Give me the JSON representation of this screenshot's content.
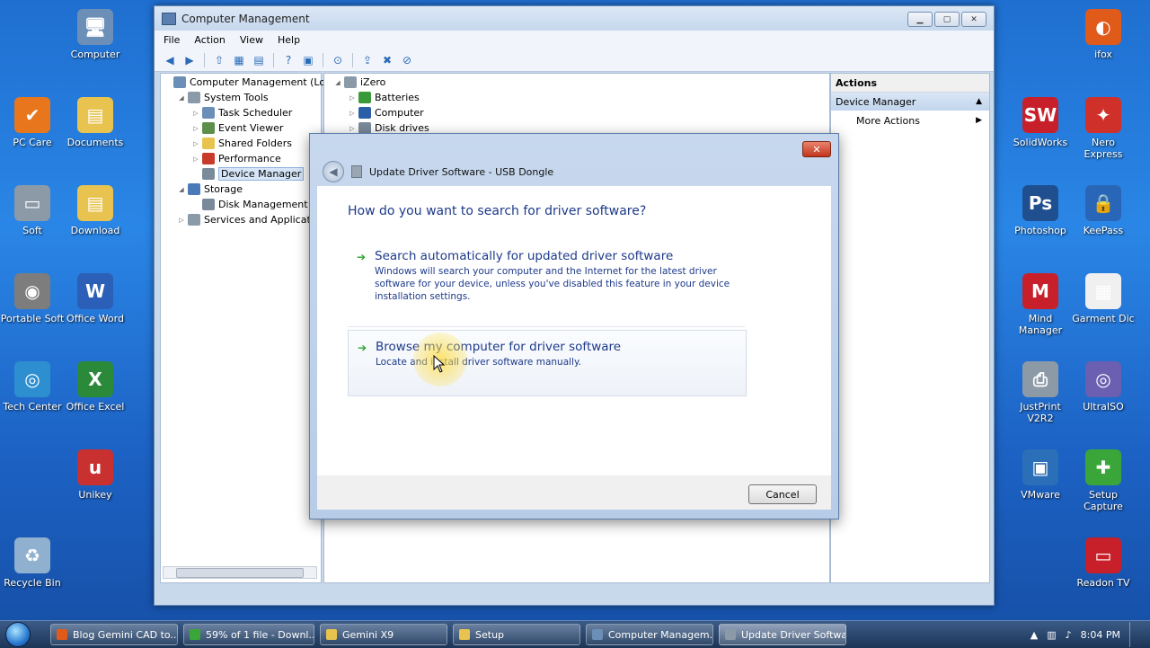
{
  "desktop_icons": [
    {
      "id": "computer",
      "label": "Computer",
      "color": "#6c8fb8",
      "glyph": "🖥"
    },
    {
      "id": "pc-care",
      "label": "PC Care",
      "color": "#e8761c",
      "glyph": "✔"
    },
    {
      "id": "documents",
      "label": "Documents",
      "color": "#e8c34f",
      "glyph": "▤"
    },
    {
      "id": "soft",
      "label": "Soft",
      "color": "#8c9aa8",
      "glyph": "▭"
    },
    {
      "id": "download",
      "label": "Download",
      "color": "#e8c34f",
      "glyph": "▤"
    },
    {
      "id": "portable-soft",
      "label": "Portable Soft",
      "color": "#7d7d7d",
      "glyph": "◉"
    },
    {
      "id": "office-word",
      "label": "Office Word",
      "color": "#2b5fb8",
      "glyph": "W"
    },
    {
      "id": "tech-center",
      "label": "Tech Center",
      "color": "#2e8fd0",
      "glyph": "◎"
    },
    {
      "id": "office-excel",
      "label": "Office Excel",
      "color": "#2a8a3a",
      "glyph": "X"
    },
    {
      "id": "unikey",
      "label": "Unikey",
      "color": "#c93030",
      "glyph": "u"
    },
    {
      "id": "recycle-bin",
      "label": "Recycle Bin",
      "color": "#8fb0cf",
      "glyph": "♻"
    },
    {
      "id": "ifox",
      "label": "ifox",
      "color": "#e05a1a",
      "glyph": "◐"
    },
    {
      "id": "solidworks",
      "label": "SolidWorks",
      "color": "#c8202a",
      "glyph": "SW"
    },
    {
      "id": "nero-express",
      "label": "Nero Express",
      "color": "#d0302a",
      "glyph": "✦"
    },
    {
      "id": "photoshop",
      "label": "Photoshop",
      "color": "#1f4f8f",
      "glyph": "Ps"
    },
    {
      "id": "keepass",
      "label": "KeePass",
      "color": "#2a66b8",
      "glyph": "🔒"
    },
    {
      "id": "mind-manager",
      "label": "Mind Manager",
      "color": "#c8202a",
      "glyph": "M"
    },
    {
      "id": "garment-dic",
      "label": "Garment Dic",
      "color": "#f0f0f0",
      "glyph": "▦"
    },
    {
      "id": "justprint",
      "label": "JustPrint V2R2",
      "color": "#8c9aa8",
      "glyph": "⎙"
    },
    {
      "id": "ultraiso",
      "label": "UltraISO",
      "color": "#6a5fb0",
      "glyph": "◎"
    },
    {
      "id": "vmware",
      "label": "VMware",
      "color": "#2a6fb8",
      "glyph": "▣"
    },
    {
      "id": "setup-capture",
      "label": "Setup Capture",
      "color": "#3aa63a",
      "glyph": "✚"
    },
    {
      "id": "readon-tv",
      "label": "Readon TV",
      "color": "#c8202a",
      "glyph": "▭"
    }
  ],
  "main_window": {
    "title": "Computer Management",
    "menu": [
      "File",
      "Action",
      "View",
      "Help"
    ],
    "tree": [
      {
        "label": "Computer Management (Local",
        "indent": 0,
        "arrow": "",
        "color": "#6c8fb8"
      },
      {
        "label": "System Tools",
        "indent": 1,
        "arrow": "◢",
        "color": "#8a9aa8"
      },
      {
        "label": "Task Scheduler",
        "indent": 2,
        "arrow": "▷",
        "color": "#6c8fb8"
      },
      {
        "label": "Event Viewer",
        "indent": 2,
        "arrow": "▷",
        "color": "#5d8f4a"
      },
      {
        "label": "Shared Folders",
        "indent": 2,
        "arrow": "▷",
        "color": "#e8c34f"
      },
      {
        "label": "Performance",
        "indent": 2,
        "arrow": "▷",
        "color": "#c83a2a"
      },
      {
        "label": "Device Manager",
        "indent": 2,
        "arrow": "",
        "color": "#7a8a9a",
        "selected": true
      },
      {
        "label": "Storage",
        "indent": 1,
        "arrow": "◢",
        "color": "#4a7ab8"
      },
      {
        "label": "Disk Management",
        "indent": 2,
        "arrow": "",
        "color": "#7a8a9a"
      },
      {
        "label": "Services and Applications",
        "indent": 1,
        "arrow": "▷",
        "color": "#8a9aa8"
      }
    ],
    "device_tree": [
      {
        "label": "iZero",
        "indent": 0,
        "arrow": "◢",
        "color": "#8a9aa8"
      },
      {
        "label": "Batteries",
        "indent": 1,
        "arrow": "▷",
        "color": "#3a9a3a"
      },
      {
        "label": "Computer",
        "indent": 1,
        "arrow": "▷",
        "color": "#2a5fa8"
      },
      {
        "label": "Disk drives",
        "indent": 1,
        "arrow": "▷",
        "color": "#7a8a9a"
      }
    ],
    "actions": {
      "header": "Actions",
      "sub": "Device Manager",
      "more": "More Actions"
    }
  },
  "dialog": {
    "title": "Update Driver Software - USB Dongle",
    "close": "✕",
    "question": "How do you want to search for driver software?",
    "option1": {
      "title": "Search automatically for updated driver software",
      "desc": "Windows will search your computer and the Internet for the latest driver software for your device, unless you've disabled this feature in your device installation settings."
    },
    "option2": {
      "title": "Browse my computer for driver software",
      "desc": "Locate and install driver software manually."
    },
    "cancel": "Cancel"
  },
  "taskbar": {
    "tasks": [
      {
        "label": "Blog Gemini CAD to...",
        "color": "#e05a1a",
        "width": 142
      },
      {
        "label": "59% of 1 file - Downl...",
        "color": "#3aa63a",
        "width": 146
      },
      {
        "label": "Gemini X9",
        "color": "#e8c34f",
        "width": 142
      },
      {
        "label": "Setup",
        "color": "#e8c34f",
        "width": 142
      },
      {
        "label": "Computer Managem...",
        "color": "#6c8fb8",
        "width": 142
      },
      {
        "label": "Update Driver Softwa...",
        "color": "#8c9aa8",
        "width": 142,
        "active": true
      }
    ],
    "time": "8:04 PM"
  }
}
